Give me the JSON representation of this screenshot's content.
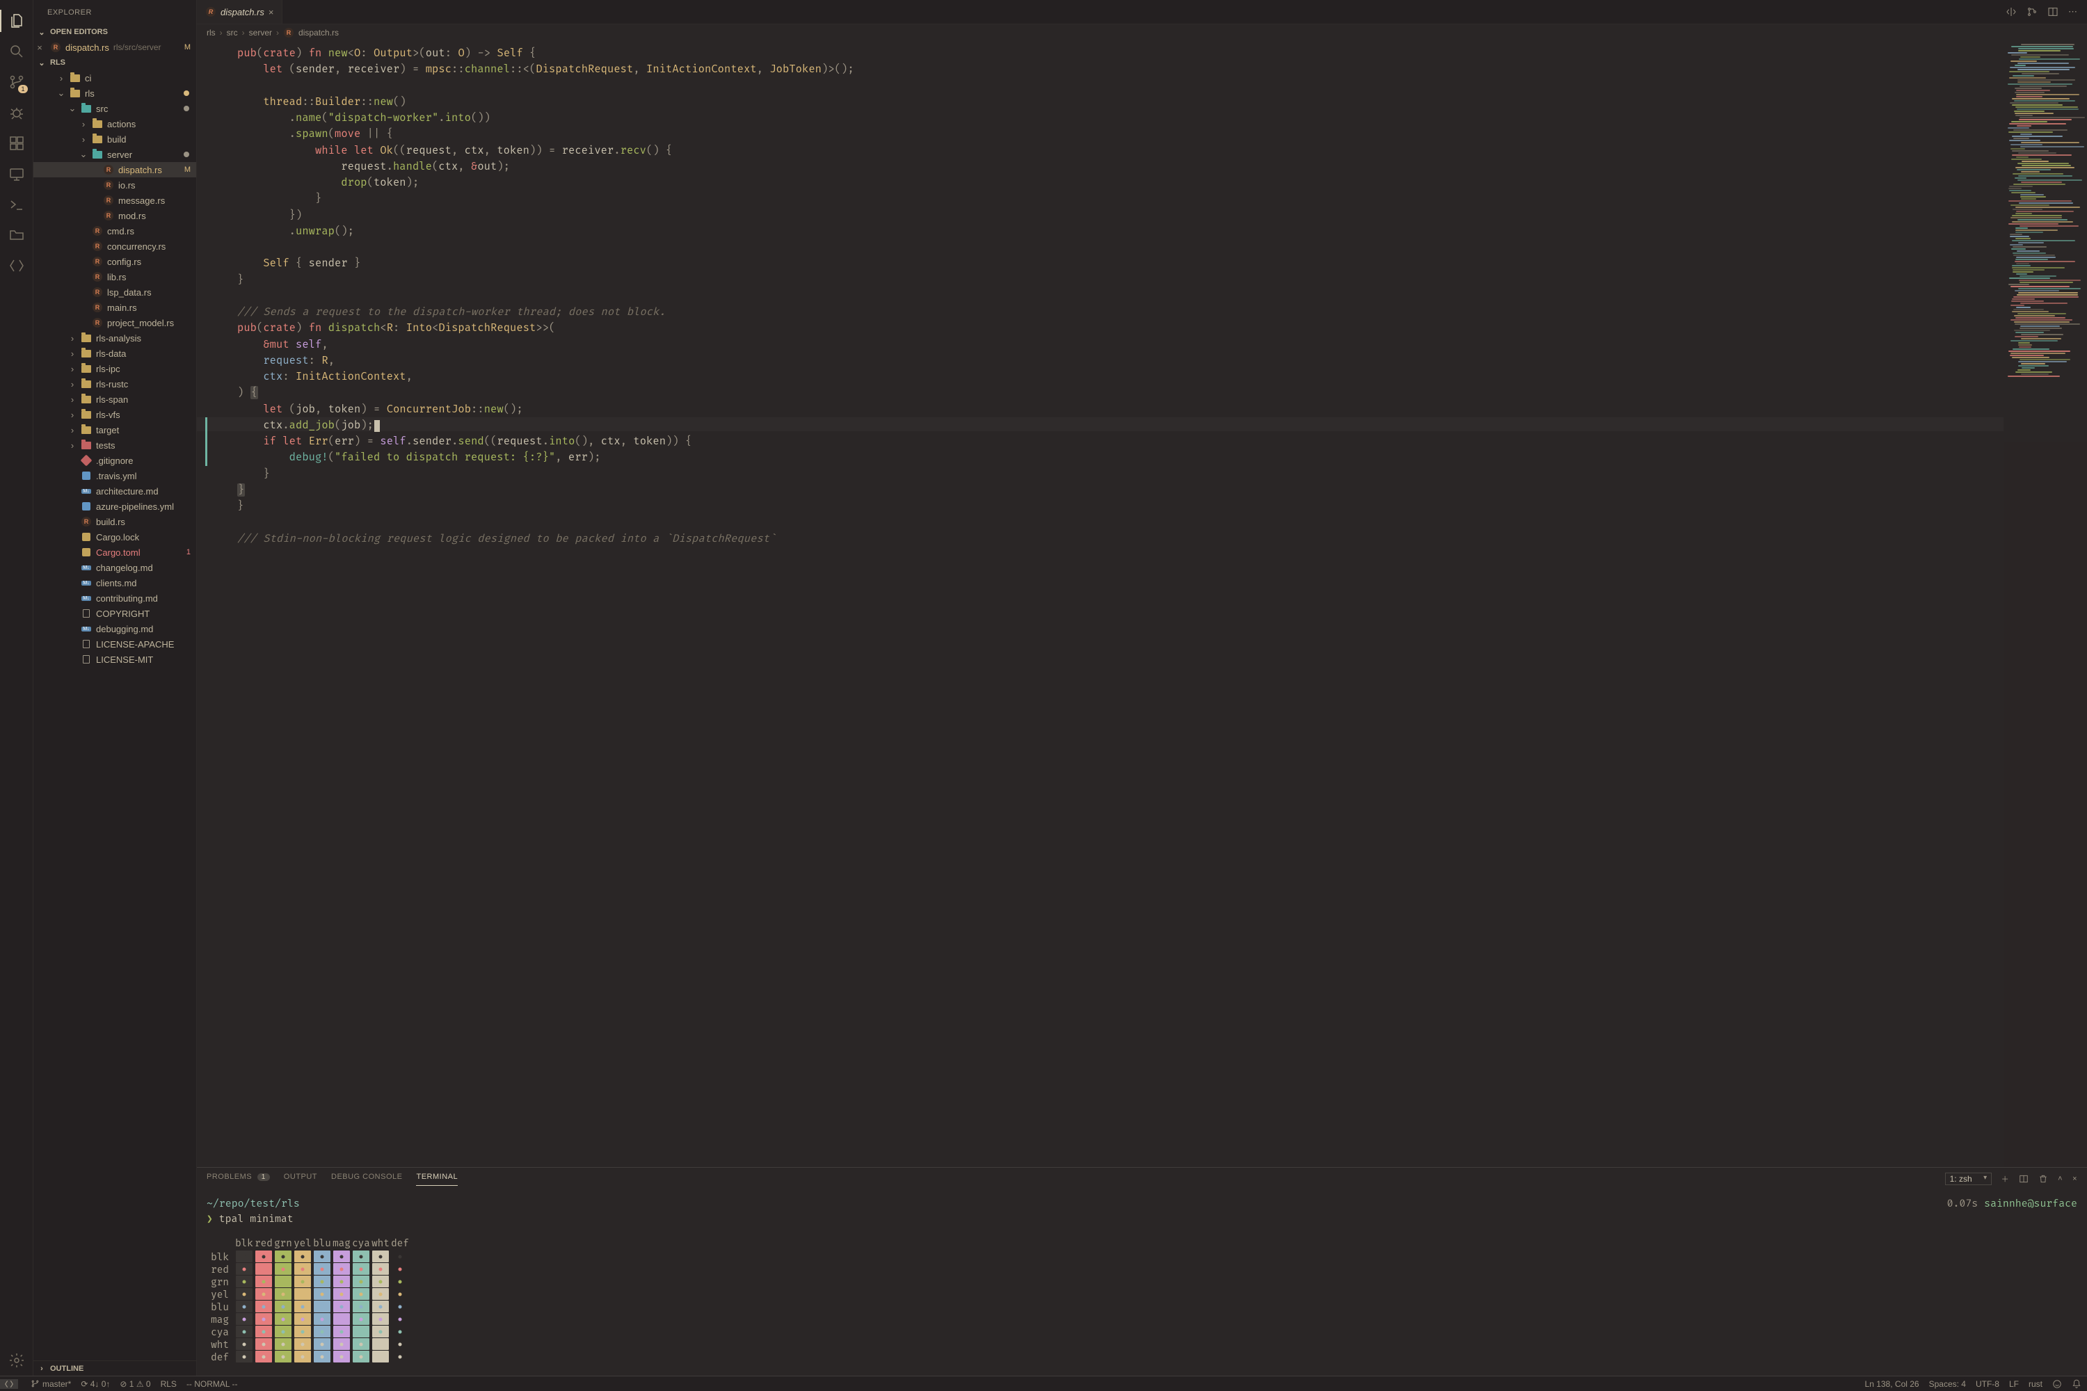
{
  "activity": {
    "badge_scm": "1"
  },
  "sidebar": {
    "title": "EXPLORER",
    "open_editors_label": "OPEN EDITORS",
    "open_editors": [
      {
        "name": "dispatch.rs",
        "path": "rls/src/server",
        "badge": "M"
      }
    ],
    "workspace_label": "RLS",
    "outline_label": "OUTLINE",
    "tree": [
      {
        "d": 1,
        "t": "folder",
        "n": "ci",
        "c": "gold",
        "chev": ">"
      },
      {
        "d": 1,
        "t": "folder-open",
        "n": "rls",
        "c": "gold",
        "chev": "v",
        "dot": "mod"
      },
      {
        "d": 2,
        "t": "folder-open",
        "n": "src",
        "c": "teal",
        "chev": "v",
        "dot": "plain"
      },
      {
        "d": 3,
        "t": "folder",
        "n": "actions",
        "c": "gold",
        "chev": ">"
      },
      {
        "d": 3,
        "t": "folder",
        "n": "build",
        "c": "gold",
        "chev": ">"
      },
      {
        "d": 3,
        "t": "folder-open",
        "n": "server",
        "c": "teal",
        "chev": "v",
        "dot": "plain"
      },
      {
        "d": 4,
        "t": "rs",
        "n": "dispatch.rs",
        "sel": true,
        "mod": true,
        "badge": "M"
      },
      {
        "d": 4,
        "t": "rs",
        "n": "io.rs"
      },
      {
        "d": 4,
        "t": "rs",
        "n": "message.rs"
      },
      {
        "d": 4,
        "t": "rs",
        "n": "mod.rs"
      },
      {
        "d": 3,
        "t": "rs",
        "n": "cmd.rs"
      },
      {
        "d": 3,
        "t": "rs",
        "n": "concurrency.rs"
      },
      {
        "d": 3,
        "t": "rs",
        "n": "config.rs"
      },
      {
        "d": 3,
        "t": "rs",
        "n": "lib.rs"
      },
      {
        "d": 3,
        "t": "rs",
        "n": "lsp_data.rs"
      },
      {
        "d": 3,
        "t": "rs",
        "n": "main.rs"
      },
      {
        "d": 3,
        "t": "rs",
        "n": "project_model.rs"
      },
      {
        "d": 2,
        "t": "folder",
        "n": "rls-analysis",
        "c": "gold",
        "chev": ">"
      },
      {
        "d": 2,
        "t": "folder",
        "n": "rls-data",
        "c": "gold",
        "chev": ">"
      },
      {
        "d": 2,
        "t": "folder",
        "n": "rls-ipc",
        "c": "gold",
        "chev": ">"
      },
      {
        "d": 2,
        "t": "folder",
        "n": "rls-rustc",
        "c": "gold",
        "chev": ">"
      },
      {
        "d": 2,
        "t": "folder",
        "n": "rls-span",
        "c": "gold",
        "chev": ">"
      },
      {
        "d": 2,
        "t": "folder",
        "n": "rls-vfs",
        "c": "gold",
        "chev": ">"
      },
      {
        "d": 2,
        "t": "folder",
        "n": "target",
        "c": "gold",
        "chev": ">"
      },
      {
        "d": 2,
        "t": "folder",
        "n": "tests",
        "c": "red",
        "chev": ">"
      },
      {
        "d": 2,
        "t": "git",
        "n": ".gitignore"
      },
      {
        "d": 2,
        "t": "yml",
        "n": ".travis.yml"
      },
      {
        "d": 2,
        "t": "md",
        "n": "architecture.md"
      },
      {
        "d": 2,
        "t": "yml",
        "n": "azure-pipelines.yml"
      },
      {
        "d": 2,
        "t": "rs",
        "n": "build.rs"
      },
      {
        "d": 2,
        "t": "lock",
        "n": "Cargo.lock"
      },
      {
        "d": 2,
        "t": "toml",
        "n": "Cargo.toml",
        "err": true,
        "badge": "1"
      },
      {
        "d": 2,
        "t": "md",
        "n": "changelog.md"
      },
      {
        "d": 2,
        "t": "md",
        "n": "clients.md"
      },
      {
        "d": 2,
        "t": "md",
        "n": "contributing.md"
      },
      {
        "d": 2,
        "t": "txt",
        "n": "COPYRIGHT"
      },
      {
        "d": 2,
        "t": "md",
        "n": "debugging.md"
      },
      {
        "d": 2,
        "t": "txt",
        "n": "LICENSE-APACHE"
      },
      {
        "d": 2,
        "t": "txt",
        "n": "LICENSE-MIT"
      }
    ]
  },
  "tab": {
    "name": "dispatch.rs"
  },
  "breadcrumb": [
    "rls",
    "src",
    "server",
    "dispatch.rs"
  ],
  "panel": {
    "tabs": {
      "problems": "PROBLEMS",
      "problems_badge": "1",
      "output": "OUTPUT",
      "debug": "DEBUG CONSOLE",
      "terminal": "TERMINAL"
    },
    "term_select": "1: zsh",
    "cwd": "~/repo/test/rls",
    "prompt": "❯ ",
    "cmd": "tpal minimat",
    "time": "0.07s",
    "userhost": "sainnhe@surface",
    "col_heads": [
      "blk",
      "red",
      "grn",
      "yel",
      "blu",
      "mag",
      "cya",
      "wht",
      "def"
    ],
    "row_labels": [
      "blk",
      "red",
      "grn",
      "yel",
      "blu",
      "mag",
      "cya",
      "wht",
      "def"
    ],
    "cols": {
      "blk": "#3a3634",
      "red": "#e67e7e",
      "grn": "#a8b85e",
      "yel": "#d9b878",
      "blu": "#8fb0c9",
      "mag": "#c79edc",
      "cya": "#8ec0b0",
      "wht": "#cfc7b2",
      "def": "#2a2626"
    }
  },
  "status": {
    "branch": "master*",
    "sync": "⟳ 4↓ 0↑",
    "errs": "⊘ 1 ⚠ 0",
    "rls": "RLS",
    "mode": "-- NORMAL --",
    "pos": "Ln 138, Col 26",
    "spaces": "Spaces: 4",
    "enc": "UTF-8",
    "eol": "LF",
    "lang": "rust"
  }
}
